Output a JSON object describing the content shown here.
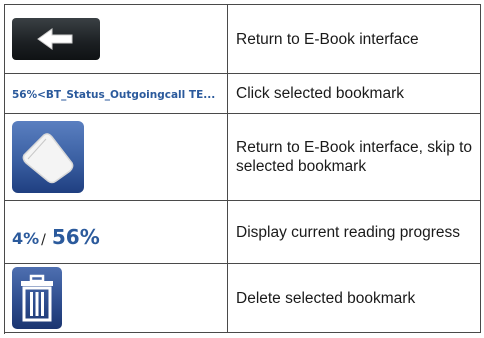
{
  "rows": [
    {
      "icon": "back-arrow-button",
      "description": "Return to E-Book interface"
    },
    {
      "icon_text": "56%<BT_Status_Outgoingcall TE...",
      "description": "Click selected bookmark"
    },
    {
      "icon": "book-page-icon",
      "description": "Return to E-Book interface, skip to selected bookmark"
    },
    {
      "progress_values": [
        "4%",
        "56%"
      ],
      "separator": "/",
      "description": "Display current reading progress"
    },
    {
      "icon": "trash-icon",
      "description": "Delete selected bookmark"
    }
  ],
  "colors": {
    "link_blue": "#2b5a9c",
    "button_dark": "#1b1f22",
    "icon_blue": "#3a5fa2",
    "border": "#4a4a4a"
  }
}
